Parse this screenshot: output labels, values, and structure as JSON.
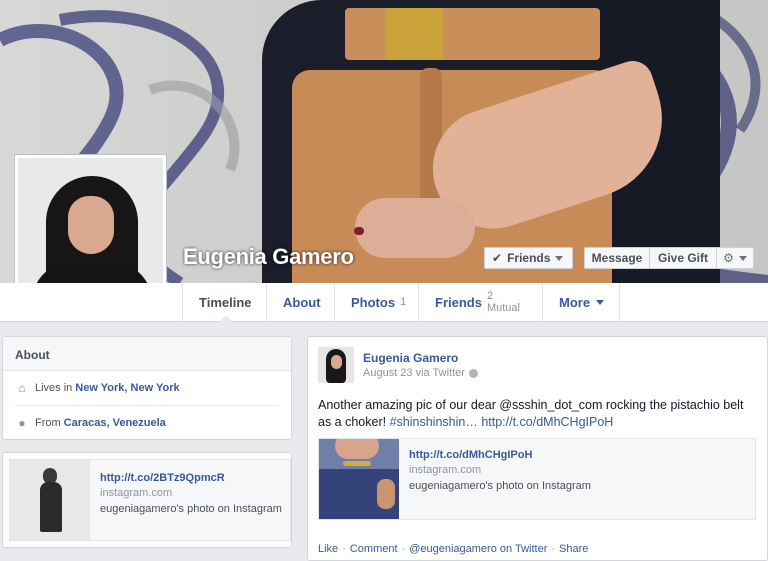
{
  "profile": {
    "name": "Eugenia Gamero"
  },
  "cover_buttons": {
    "friends_label": "Friends",
    "message_label": "Message",
    "gift_label": "Give Gift"
  },
  "tabs": [
    {
      "label": "Timeline",
      "count": ""
    },
    {
      "label": "About",
      "count": ""
    },
    {
      "label": "Photos",
      "count": "1"
    },
    {
      "label": "Friends",
      "count": "2 Mutual"
    },
    {
      "label": "More",
      "count": ""
    }
  ],
  "about": {
    "title": "About",
    "lives_prefix": "Lives in",
    "lives_value": "New York, New York",
    "from_prefix": "From",
    "from_value": "Caracas, Venezuela"
  },
  "left_card": {
    "link": "http://t.co/2BTz9QpmcR",
    "domain": "instagram.com",
    "caption": "eugeniagamero's photo on Instagram"
  },
  "post": {
    "author": "Eugenia Gamero",
    "meta": "August 23 via Twitter",
    "text_main": "Another amazing pic of our dear @ssshin_dot_com rocking the pistachio belt as a choker! ",
    "hashtag": "#shinshinshin…",
    "text_link": "http://t.co/dMhCHgIPoH",
    "share_link": "http://t.co/dMhCHgIPoH",
    "share_domain": "instagram.com",
    "share_caption": "eugeniagamero's photo on Instagram",
    "actions": [
      "Like",
      "Comment",
      "@eugeniagamero on Twitter",
      "Share"
    ]
  },
  "colors": {
    "link": "#3b5998",
    "background": "#e9eaed"
  }
}
